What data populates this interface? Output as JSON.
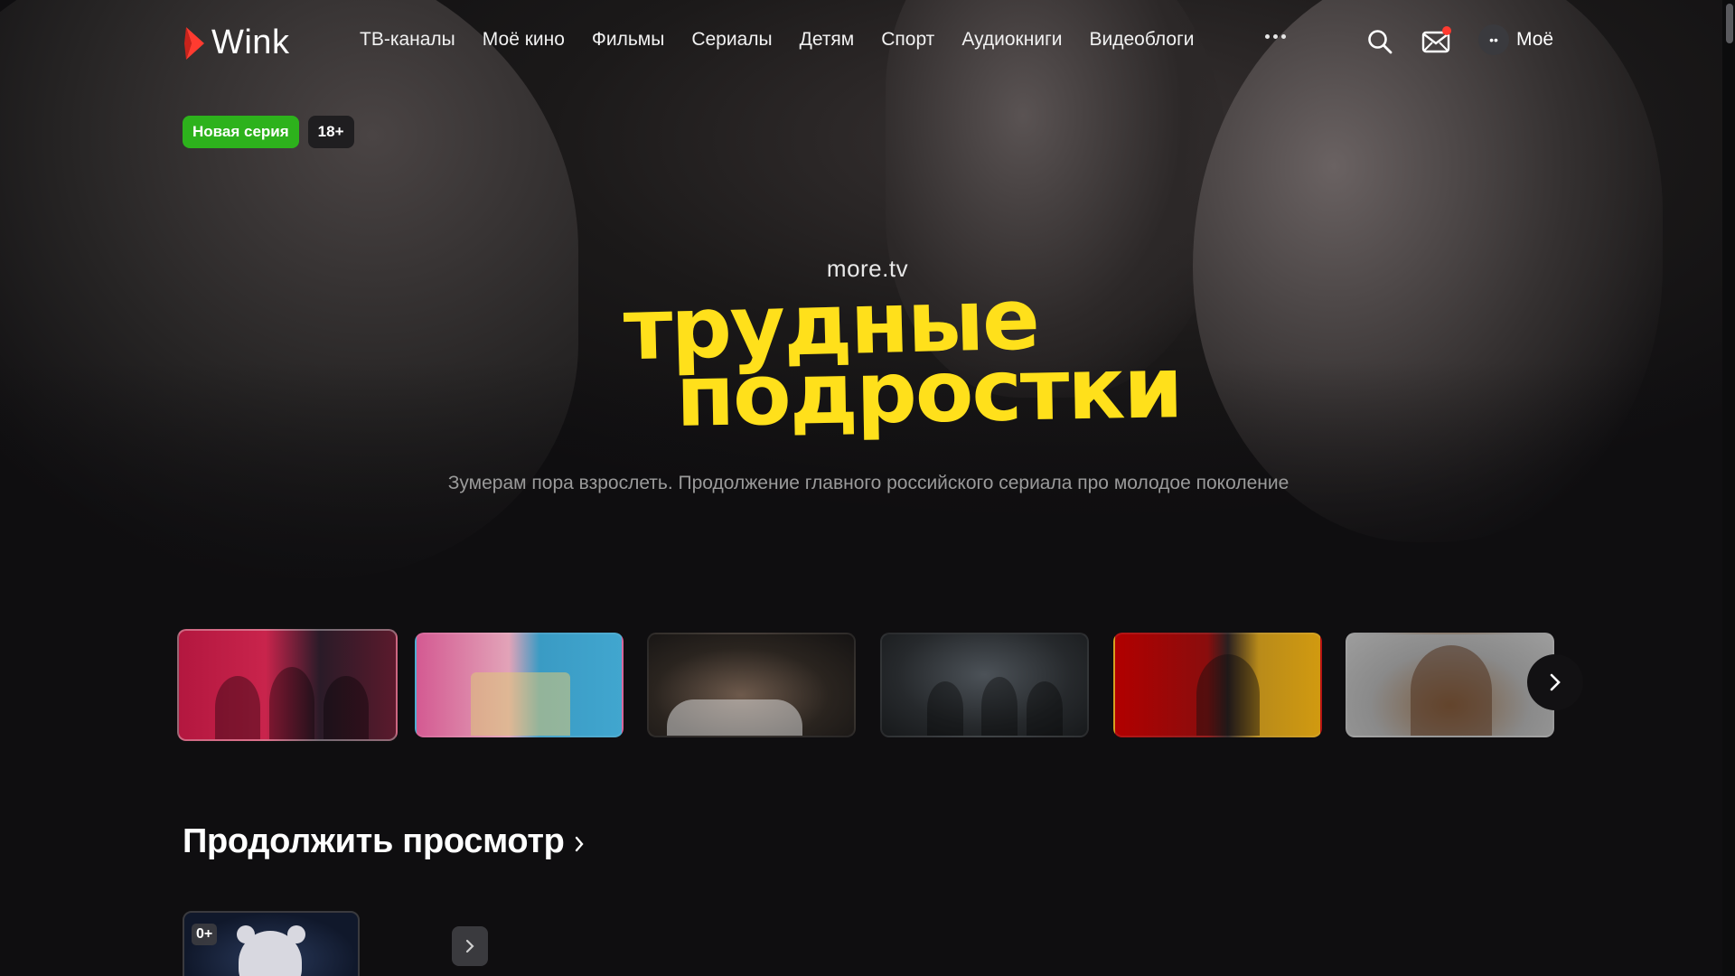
{
  "app": {
    "name": "Wink",
    "brand_color": "#ff3b30"
  },
  "nav": {
    "items": [
      {
        "label": "ТВ-каналы"
      },
      {
        "label": "Моё кино"
      },
      {
        "label": "Фильмы"
      },
      {
        "label": "Сериалы"
      },
      {
        "label": "Детям"
      },
      {
        "label": "Спорт"
      },
      {
        "label": "Аудиокниги"
      },
      {
        "label": "Видеоблоги"
      }
    ],
    "more_icon": "ellipsis-icon",
    "search_icon": "search-icon",
    "mail_icon": "mail-icon",
    "profile_label": "Моё"
  },
  "hero": {
    "badge_new": "Новая серия",
    "badge_age": "18+",
    "brand": "more.tv",
    "title_line1": "трудные",
    "title_line2": "подростки",
    "title_color": "#ffe01b",
    "description": "Зумерам пора взрослеть. Продолжение главного российского сериала про молодое поколение",
    "new_badge_color": "#2db21c"
  },
  "carousel": {
    "count": 6,
    "active_index": 0,
    "next_icon": "chevron-right-icon"
  },
  "continue_watching": {
    "title": "Продолжить просмотр",
    "items": [
      {
        "age": "0+"
      }
    ]
  }
}
